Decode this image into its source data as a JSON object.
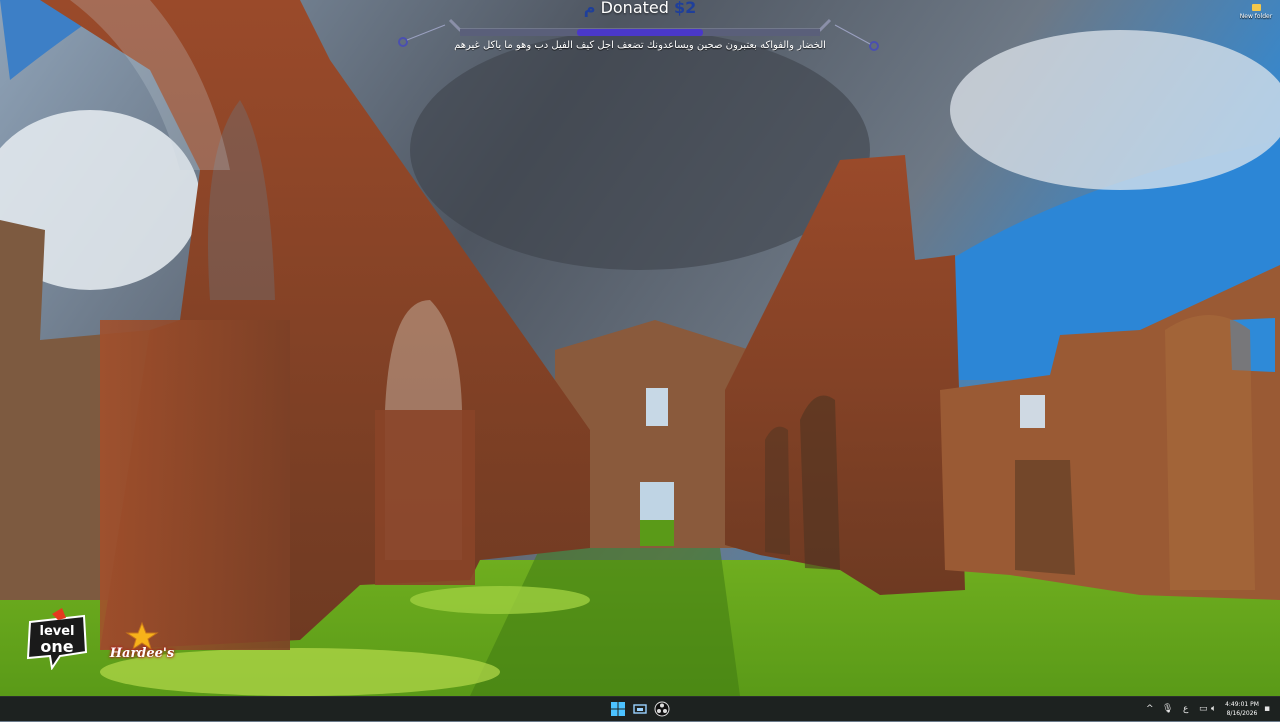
{
  "overlay": {
    "donated_label": "Donated",
    "donated_amount": "$2",
    "currency_symbol": "م",
    "scroll_text": "الخضار والفواكه بعتبرون صحين ويساعدونك تضعف اجل كيف الفيل دب وهو ما ياكل غيرهم",
    "progress_fraction": 0.35,
    "progress_color": "#4a38c9"
  },
  "desktop_icons": [
    {
      "name": "folder-icon",
      "label": "New folder"
    }
  ],
  "logos": {
    "level_one": "level one",
    "hardees": "Hardee's"
  },
  "taskbar": {
    "apps": [
      "start",
      "task-view",
      "obs"
    ],
    "tray": {
      "chevron": "^",
      "language": "ع"
    },
    "clock": {
      "time": "4:49:01 PM",
      "date": "8/16/2026"
    }
  },
  "colors": {
    "taskbar_bg": "#1d2220",
    "accent": "#4a38c9",
    "sky": "#2f86d8"
  }
}
